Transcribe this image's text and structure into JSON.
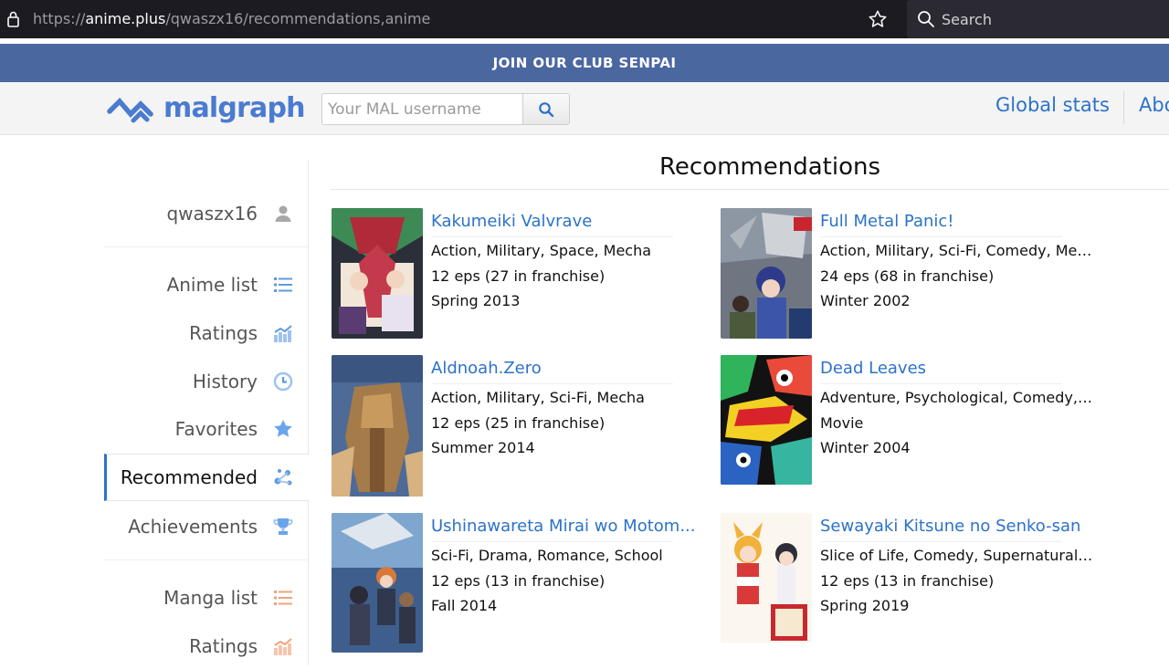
{
  "browser": {
    "url_prefix": "https://",
    "url_host": "anime.plus",
    "url_path": "/qwaszx16/recommendations,anime",
    "search_label": "Search"
  },
  "banner": {
    "text": "JOIN OUR CLUB SENPAI"
  },
  "header": {
    "logo_text": "malgraph",
    "username_placeholder": "Your MAL username",
    "nav": [
      "Global stats",
      "Abo"
    ]
  },
  "sidebar": {
    "username": "qwaszx16",
    "items": [
      {
        "label": "Anime list",
        "icon": "list-icon"
      },
      {
        "label": "Ratings",
        "icon": "bar-chart-icon"
      },
      {
        "label": "History",
        "icon": "history-icon"
      },
      {
        "label": "Favorites",
        "icon": "star-icon"
      },
      {
        "label": "Recommended",
        "icon": "recommend-icon"
      },
      {
        "label": "Achievements",
        "icon": "trophy-icon"
      },
      {
        "label": "Manga list",
        "icon": "list-icon"
      },
      {
        "label": "Ratings",
        "icon": "bar-chart-icon"
      }
    ]
  },
  "main": {
    "title": "Recommendations",
    "cards": [
      {
        "title": "Kakumeiki Valvrave",
        "genres": "Action, Military, Space, Mecha",
        "eps": "12 eps (27 in franchise)",
        "season": "Spring 2013"
      },
      {
        "title": "Full Metal Panic!",
        "genres": "Action, Military, Sci-Fi, Comedy, Mec...",
        "eps": "24 eps (68 in franchise)",
        "season": "Winter 2002"
      },
      {
        "title": "Aldnoah.Zero",
        "genres": "Action, Military, Sci-Fi, Mecha",
        "eps": "12 eps (25 in franchise)",
        "season": "Summer 2014"
      },
      {
        "title": "Dead Leaves",
        "genres": "Adventure, Psychological, Comedy, ...",
        "eps": "Movie",
        "season": "Winter 2004"
      },
      {
        "title": "Ushinawareta Mirai wo Motom...",
        "genres": "Sci-Fi, Drama, Romance, School",
        "eps": "12 eps (13 in franchise)",
        "season": "Fall 2014"
      },
      {
        "title": "Sewayaki Kitsune no Senko-san",
        "genres": "Slice of Life, Comedy, Supernatural,...",
        "eps": "12 eps (13 in franchise)",
        "season": "Spring 2019"
      }
    ]
  }
}
